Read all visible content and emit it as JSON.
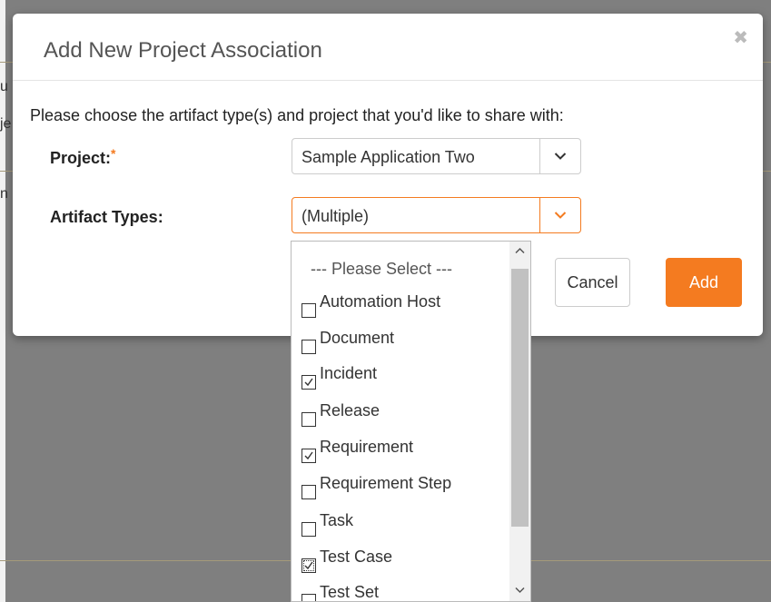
{
  "background": {
    "fragments": [
      "u",
      "je",
      "n"
    ]
  },
  "modal": {
    "title": "Add New Project Association",
    "instructions": "Please choose the artifact type(s) and project that you'd like to share with:",
    "project": {
      "label": "Project:",
      "required_mark": "*",
      "value": "Sample Application Two"
    },
    "artifact_types": {
      "label": "Artifact Types:",
      "value": "(Multiple)"
    },
    "buttons": {
      "cancel": "Cancel",
      "add": "Add"
    }
  },
  "dropdown": {
    "header": "--- Please Select ---",
    "options": [
      {
        "label": "Automation Host",
        "checked": false
      },
      {
        "label": "Document",
        "checked": false
      },
      {
        "label": "Incident",
        "checked": true
      },
      {
        "label": "Release",
        "checked": false
      },
      {
        "label": "Requirement",
        "checked": true
      },
      {
        "label": "Requirement Step",
        "checked": false
      },
      {
        "label": "Task",
        "checked": false
      },
      {
        "label": "Test Case",
        "checked": true,
        "focused": true
      },
      {
        "label": "Test Set",
        "checked": false
      }
    ]
  },
  "colors": {
    "accent": "#f47b20",
    "overlay": "#7f7f7f"
  }
}
